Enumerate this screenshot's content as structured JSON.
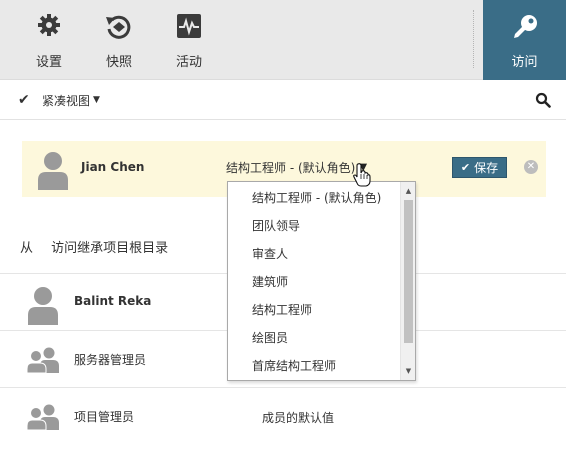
{
  "toolbar": {
    "items": [
      {
        "label": "设置",
        "icon": "gear-icon"
      },
      {
        "label": "快照",
        "icon": "snapshot-icon"
      },
      {
        "label": "活动",
        "icon": "activity-icon"
      }
    ],
    "active": {
      "label": "访问",
      "icon": "key-icon"
    }
  },
  "subbar": {
    "view_label": "紧凑视图",
    "search_icon": "search-icon"
  },
  "editing": {
    "name": "Jian Chen",
    "role": "结构工程师 - (默认角色)",
    "save_label": "保存"
  },
  "dropdown": {
    "options": [
      "结构工程师 - (默认角色)",
      "团队领导",
      "审查人",
      "建筑师",
      "结构工程师",
      "绘图员",
      "首席结构工程师"
    ]
  },
  "inherit": {
    "from": "从",
    "text": "访问继承项目根目录"
  },
  "members": [
    {
      "name": "Balint Reka",
      "role": "",
      "type": "user"
    },
    {
      "name": "服务器管理员",
      "role": "",
      "type": "group"
    },
    {
      "name": "项目管理员",
      "role": "成员的默认值",
      "type": "group"
    }
  ],
  "colors": {
    "accent": "#3a6d87",
    "highlight_row": "#fdf8dc",
    "toolbar_bg": "#e9e9e9"
  }
}
